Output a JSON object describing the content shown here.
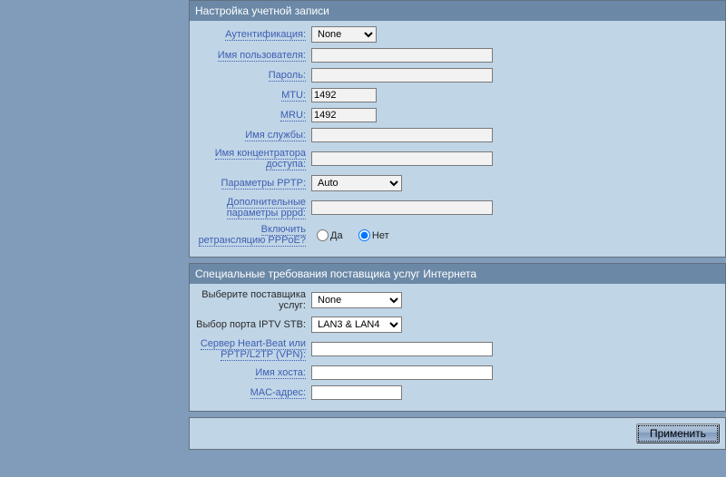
{
  "section1": {
    "title": "Настройка учетной записи",
    "auth": {
      "label": "Аутентификация:",
      "value": "None"
    },
    "user": {
      "label": "Имя пользователя:",
      "value": ""
    },
    "pass": {
      "label": "Пароль:",
      "value": ""
    },
    "mtu": {
      "label": "MTU:",
      "value": "1492"
    },
    "mru": {
      "label": "MRU:",
      "value": "1492"
    },
    "serviceName": {
      "label": "Имя службы:",
      "value": ""
    },
    "acName": {
      "label": "Имя концентратора доступа:",
      "value": ""
    },
    "pptpParams": {
      "label": "Параметры PPTP:",
      "value": "Auto"
    },
    "pppdExtra": {
      "label": "Дополнительные параметры pppd:",
      "value": ""
    },
    "pppoeRelay": {
      "label": "Включить ретрансляцию PPPoE?",
      "yes": "Да",
      "no": "Нет",
      "value": "no"
    }
  },
  "section2": {
    "title": "Специальные требования поставщика услуг Интернета",
    "isp": {
      "label": "Выберите поставщика услуг:",
      "value": "None"
    },
    "iptv": {
      "label": "Выбор порта IPTV STB:",
      "value": "LAN3 & LAN4"
    },
    "heartbeat": {
      "label": "Сервер Heart-Beat или PPTP/L2TP (VPN):",
      "value": ""
    },
    "hostname": {
      "label": "Имя хоста:",
      "value": ""
    },
    "mac": {
      "label": "MAC-адрес:",
      "value": ""
    }
  },
  "actions": {
    "apply": "Применить"
  }
}
